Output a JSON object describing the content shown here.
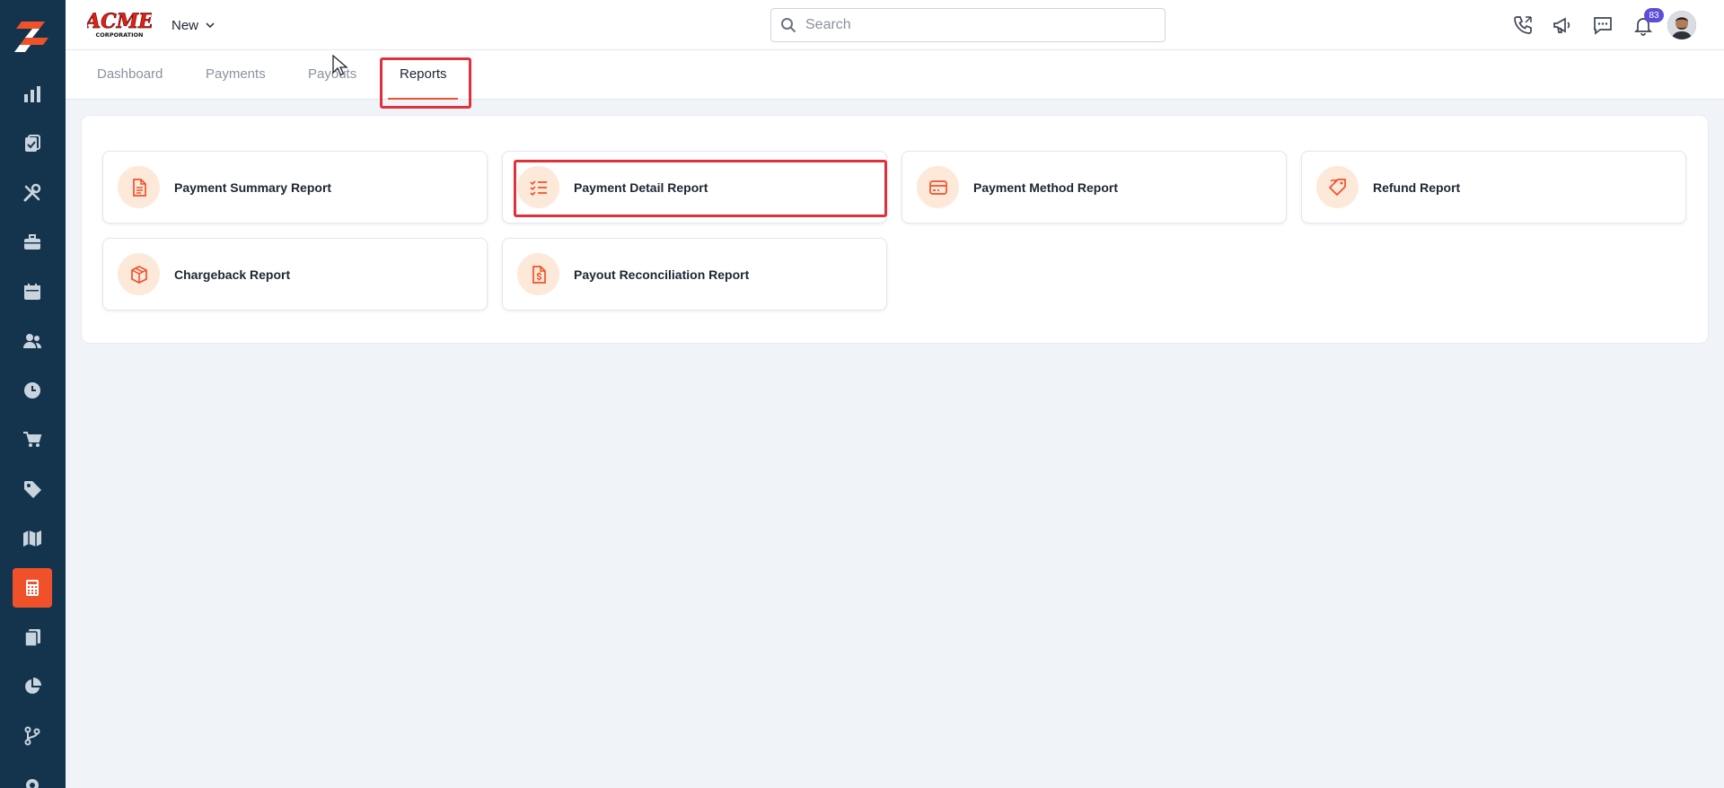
{
  "brand": {
    "logo_text": "ACME",
    "logo_subtext": "CORPORATION"
  },
  "topbar": {
    "new_label": "New",
    "search": {
      "placeholder": "Search",
      "value": ""
    },
    "notifications_count": "83",
    "icons": [
      "phone-icon",
      "megaphone-icon",
      "chat-icon",
      "bell-icon"
    ]
  },
  "sidebar": {
    "items": [
      {
        "icon": "bar-chart-icon"
      },
      {
        "icon": "clipboard-icon"
      },
      {
        "icon": "tools-icon"
      },
      {
        "icon": "briefcase-icon"
      },
      {
        "icon": "calendar-icon"
      },
      {
        "icon": "users-icon"
      },
      {
        "icon": "clock-icon"
      },
      {
        "icon": "cart-icon"
      },
      {
        "icon": "tag-icon"
      },
      {
        "icon": "map-icon"
      },
      {
        "icon": "calculator-icon",
        "active": true
      },
      {
        "icon": "documents-icon"
      },
      {
        "icon": "pie-chart-icon"
      },
      {
        "icon": "git-branch-icon"
      },
      {
        "icon": "settings-icon"
      }
    ]
  },
  "tabs": [
    {
      "label": "Dashboard"
    },
    {
      "label": "Payments"
    },
    {
      "label": "Payouts"
    },
    {
      "label": "Reports",
      "active": true
    }
  ],
  "reports": [
    {
      "label": "Payment Summary Report",
      "icon": "file-text-icon"
    },
    {
      "label": "Payment Detail Report",
      "icon": "list-check-icon"
    },
    {
      "label": "Payment Method Report",
      "icon": "credit-card-icon"
    },
    {
      "label": "Refund Report",
      "icon": "tag-refund-icon"
    },
    {
      "label": "Chargeback Report",
      "icon": "box-icon"
    },
    {
      "label": "Payout Reconciliation Report",
      "icon": "file-dollar-icon"
    }
  ],
  "colors": {
    "accent": "#f0512a",
    "sidebar": "#14344d",
    "highlight": "#e0313b",
    "badge": "#5b4fd9"
  }
}
